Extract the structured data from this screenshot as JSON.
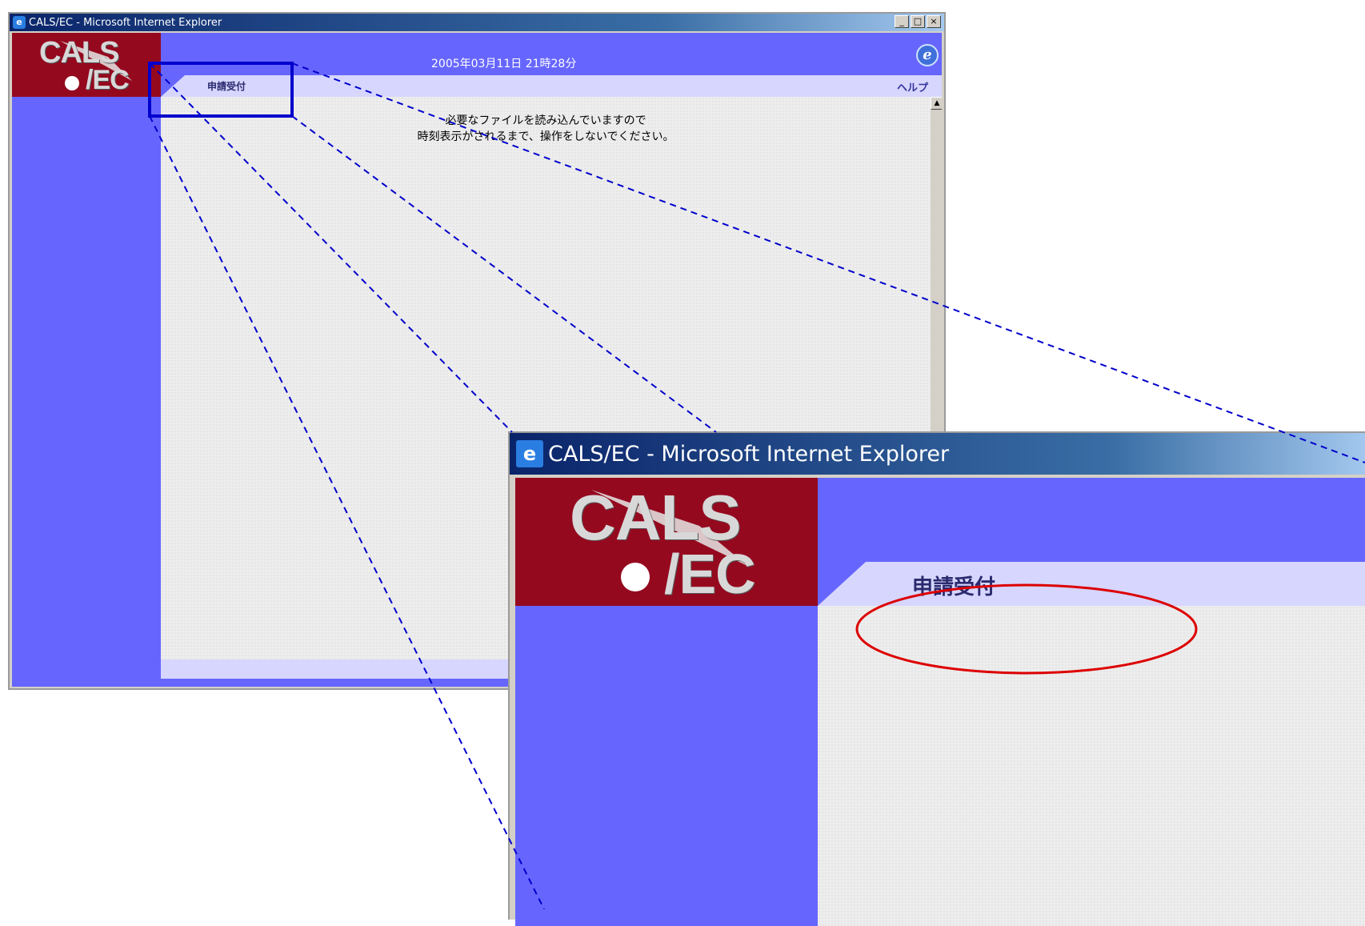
{
  "window": {
    "title": "CALS/EC - Microsoft Internet Explorer",
    "controls": {
      "minimize": "_",
      "maximize": "□",
      "close": "×"
    }
  },
  "header": {
    "logo_top": "CALS",
    "logo_bottom": "/EC",
    "datetime": "2005年03月11日 21時28分",
    "tab_label": "申請受付",
    "help_label": "ヘルプ"
  },
  "main": {
    "notice_line1": "必要なファイルを読み込んでいますので",
    "notice_line2": "時刻表示がされるまで、操作をしないでください。"
  },
  "zoom": {
    "title": "CALS/EC - Microsoft Internet Explorer",
    "logo_top": "CALS",
    "logo_bottom": "/EC",
    "tab_label": "申請受付"
  },
  "colors": {
    "page_blue": "#6666ff",
    "logo_red": "#95091f",
    "tab_strip": "#d6d6ff",
    "highlight_box": "#0000cc",
    "highlight_ellipse": "#dd0000",
    "callout_lines": "#0000cc"
  },
  "icons": {
    "ie_page_icon": "ie-page-icon",
    "ie_globe": "ie-globe-icon",
    "scroll_up": "scroll-up-arrow-icon"
  }
}
